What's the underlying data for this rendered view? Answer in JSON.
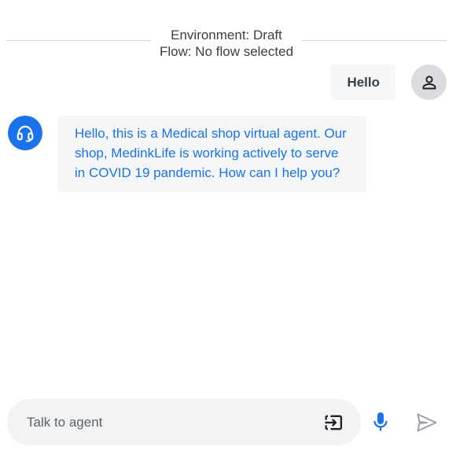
{
  "header": {
    "environment": "Environment: Draft",
    "flow": "Flow: No flow selected"
  },
  "messages": {
    "user": {
      "text": "Hello",
      "avatar_icon": "person-icon"
    },
    "agent": {
      "text": "Hello, this is a Medical shop virtual agent. Our shop, MedinkLife is working actively to serve in COVID 19 pandemic. How can I help you?",
      "avatar_icon": "headset-icon"
    }
  },
  "input": {
    "placeholder": "Talk to agent",
    "value": ""
  },
  "icons": {
    "submit": "input-submit-icon",
    "mic": "microphone-icon",
    "send": "send-icon"
  },
  "colors": {
    "accent": "#1a73e8",
    "bubble_bg": "#f5f6f8",
    "avatar_user_bg": "#dadce0",
    "input_bg": "#f1f3f4",
    "send_disabled": "#9aa0a6"
  }
}
